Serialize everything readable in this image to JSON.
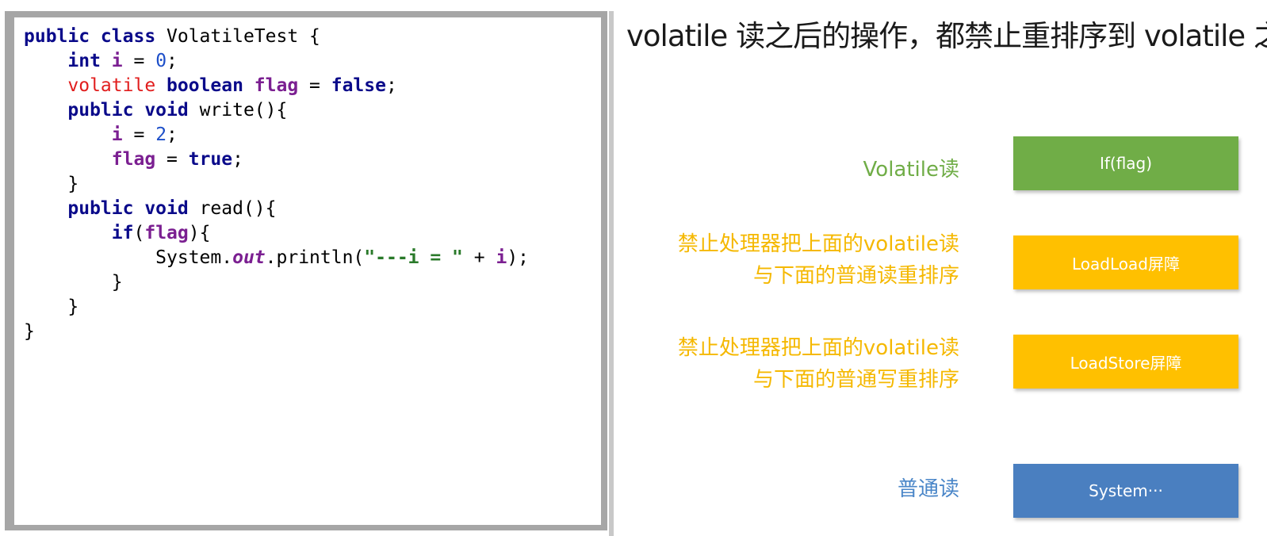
{
  "code": {
    "lines": [
      [
        {
          "t": "public class ",
          "c": "kw"
        },
        {
          "t": "VolatileTest {",
          "c": "plain"
        }
      ],
      [
        {
          "t": "    "
        },
        {
          "t": "int ",
          "c": "kw"
        },
        {
          "t": "i",
          "c": "var"
        },
        {
          "t": " = "
        },
        {
          "t": "0",
          "c": "num"
        },
        {
          "t": ";"
        }
      ],
      [
        {
          "t": "    "
        },
        {
          "t": "volatile ",
          "c": "kw-red"
        },
        {
          "t": "boolean ",
          "c": "kw"
        },
        {
          "t": "flag",
          "c": "var"
        },
        {
          "t": " = "
        },
        {
          "t": "false",
          "c": "kw"
        },
        {
          "t": ";"
        }
      ],
      [
        {
          "t": "    "
        },
        {
          "t": "public void ",
          "c": "kw"
        },
        {
          "t": "write(){"
        }
      ],
      [
        {
          "t": "        "
        },
        {
          "t": "i",
          "c": "var"
        },
        {
          "t": " = "
        },
        {
          "t": "2",
          "c": "num"
        },
        {
          "t": ";"
        }
      ],
      [
        {
          "t": "        "
        },
        {
          "t": "flag",
          "c": "var"
        },
        {
          "t": " = "
        },
        {
          "t": "true",
          "c": "kw"
        },
        {
          "t": ";"
        }
      ],
      [
        {
          "t": "    }"
        }
      ],
      [
        {
          "t": "    "
        },
        {
          "t": "public void ",
          "c": "kw"
        },
        {
          "t": "read(){"
        }
      ],
      [
        {
          "t": "        "
        },
        {
          "t": "if",
          "c": "kw"
        },
        {
          "t": "("
        },
        {
          "t": "flag",
          "c": "var"
        },
        {
          "t": "){"
        }
      ],
      [
        {
          "t": "            System."
        },
        {
          "t": "out",
          "c": "field"
        },
        {
          "t": ".println("
        },
        {
          "t": "\"---i = \"",
          "c": "str"
        },
        {
          "t": " + "
        },
        {
          "t": "i",
          "c": "var"
        },
        {
          "t": ");"
        }
      ],
      [
        {
          "t": "        }"
        }
      ],
      [
        {
          "t": "    }"
        }
      ],
      [
        {
          "t": "}"
        }
      ]
    ]
  },
  "diagram": {
    "title": "volatile 读之后的操作，都禁止重排序到 volatile 之前",
    "rows": [
      {
        "label_lines": [
          "Volatile读"
        ],
        "box": "If(flag)",
        "label_color": "#70ad47",
        "box_color": "#70ad47"
      },
      {
        "label_lines": [
          "禁止处理器把上面的volatile读",
          "与下面的普通读重排序"
        ],
        "box": "LoadLoad屏障",
        "label_color": "#f5b800",
        "box_color": "#ffc000"
      },
      {
        "label_lines": [
          "禁止处理器把上面的volatile读",
          "与下面的普通写重排序"
        ],
        "box": "LoadStore屏障",
        "label_color": "#f5b800",
        "box_color": "#ffc000"
      },
      {
        "label_lines": [
          "普通读"
        ],
        "box": "System···",
        "label_color": "#4a86c8",
        "box_color": "#4a7fc0"
      }
    ]
  }
}
